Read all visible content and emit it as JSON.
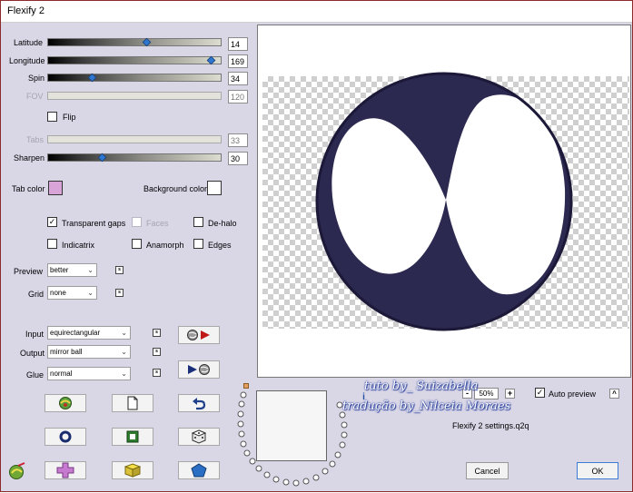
{
  "window": {
    "title": "Flexify 2"
  },
  "sliders": [
    {
      "key": "latitude",
      "label": "Latitude",
      "value": "14",
      "thumb_fraction": 0.6
    },
    {
      "key": "longitude",
      "label": "Longitude",
      "value": "169",
      "thumb_fraction": 0.96
    },
    {
      "key": "spin",
      "label": "Spin",
      "value": "34",
      "thumb_fraction": 0.25
    },
    {
      "key": "fov",
      "label": "FOV",
      "value": "120",
      "disabled": true
    },
    {
      "key": "tabs",
      "label": "Tabs",
      "value": "33",
      "disabled": true
    },
    {
      "key": "sharpen",
      "label": "Sharpen",
      "value": "30",
      "thumb_fraction": 0.31
    }
  ],
  "flip": {
    "label": "Flip",
    "checked": false
  },
  "colors": {
    "tab_color_label": "Tab color",
    "tab_color": "#d9a4d8",
    "background_color_label": "Background color",
    "background_color": "#ffffff"
  },
  "options": {
    "transparent_gaps": {
      "label": "Transparent gaps",
      "checked": true
    },
    "faces": {
      "label": "Faces",
      "checked": false,
      "disabled": true
    },
    "de_halo": {
      "label": "De-halo",
      "checked": false
    },
    "indicatrix": {
      "label": "Indicatrix",
      "checked": false
    },
    "anamorph": {
      "label": "Anamorph",
      "checked": false
    },
    "edges": {
      "label": "Edges",
      "checked": false
    }
  },
  "preview_quality": {
    "label": "Preview",
    "value": "better"
  },
  "grid": {
    "label": "Grid",
    "value": "none"
  },
  "input": {
    "label": "Input",
    "value": "equirectangular"
  },
  "output": {
    "label": "Output",
    "value": "mirror ball"
  },
  "glue": {
    "label": "Glue",
    "value": "normal"
  },
  "small_toggle": "s",
  "zoom": {
    "value": "50%",
    "minus": "-",
    "plus": "+"
  },
  "auto_preview": {
    "label": "Auto preview",
    "checked": true
  },
  "collapse_button": "^",
  "info_icon": "i",
  "settings_file": "Flexify 2 settings.q2q",
  "cancel_label": "Cancel",
  "ok_label": "OK",
  "watermark": {
    "line1": "tuto by_ Suizabella",
    "line2": "tradução by_Nilceia Moraes"
  },
  "preview_image": {
    "ring_color": "#2c2950",
    "background": "#ffffff"
  },
  "icons": [
    "random-globe-icon",
    "new-page-icon",
    "undo-arrow-icon",
    "ring-icon",
    "square-frame-icon",
    "dice-icon",
    "flexify-logo-icon",
    "cross-shape-icon",
    "cube-icon",
    "pentagon-icon"
  ]
}
